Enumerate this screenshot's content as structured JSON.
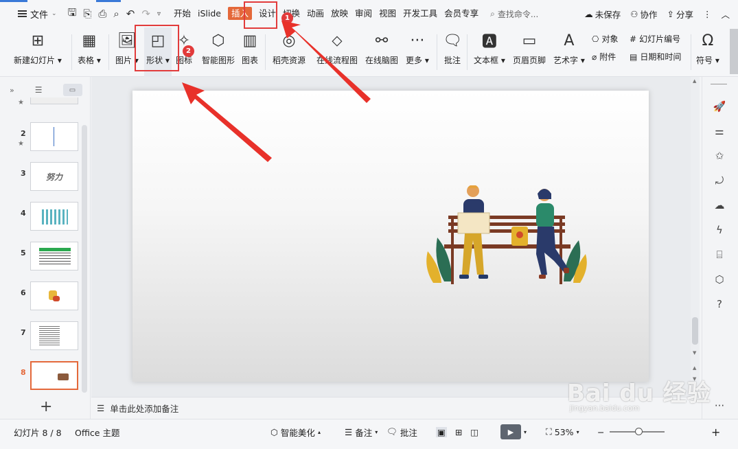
{
  "menubar": {
    "file_label": "文件",
    "tabs": [
      "开始",
      "iSlide",
      "插入",
      "设计",
      "切换",
      "动画",
      "放映",
      "审阅",
      "视图",
      "开发工具",
      "会员专享"
    ],
    "active_tab": "插入",
    "search_placeholder": "查找命令...",
    "unsaved": "未保存",
    "collab": "协作",
    "share": "分享"
  },
  "ribbon": {
    "new_slide": "新建幻灯片",
    "table": "表格",
    "picture": "图片",
    "shape": "形状",
    "icon": "图标",
    "smartart": "智能图形",
    "chart": "图表",
    "resource": "稻壳资源",
    "flowchart": "在线流程图",
    "mindmap": "在线脑图",
    "more": "更多",
    "comment": "批注",
    "textbox": "文本框",
    "header_footer": "页眉页脚",
    "wordart": "艺术字",
    "object": "对象",
    "attachment": "附件",
    "slide_number": "幻灯片编号",
    "datetime": "日期和时间",
    "symbol": "符号"
  },
  "slides": [
    {
      "num": "2",
      "star": true
    },
    {
      "num": "3",
      "star": false,
      "text": "努力"
    },
    {
      "num": "4",
      "star": false
    },
    {
      "num": "5",
      "star": false
    },
    {
      "num": "6",
      "star": false
    },
    {
      "num": "7",
      "star": false
    },
    {
      "num": "8",
      "star": false,
      "active": true
    }
  ],
  "notes_placeholder": "单击此处添加备注",
  "status": {
    "slide_counter": "幻灯片 8 / 8",
    "theme": "Office 主题",
    "beautify": "智能美化",
    "notes": "备注",
    "comments": "批注",
    "zoom": "53%",
    "zoom_level": 0.53
  },
  "annotations": {
    "badge1": "1",
    "badge2": "2"
  },
  "watermark": {
    "main": "Bai du 经验",
    "sub": "jingyan.baidu.com"
  },
  "colors": {
    "accent": "#e4683a",
    "annotation_red": "#e23b3b"
  }
}
